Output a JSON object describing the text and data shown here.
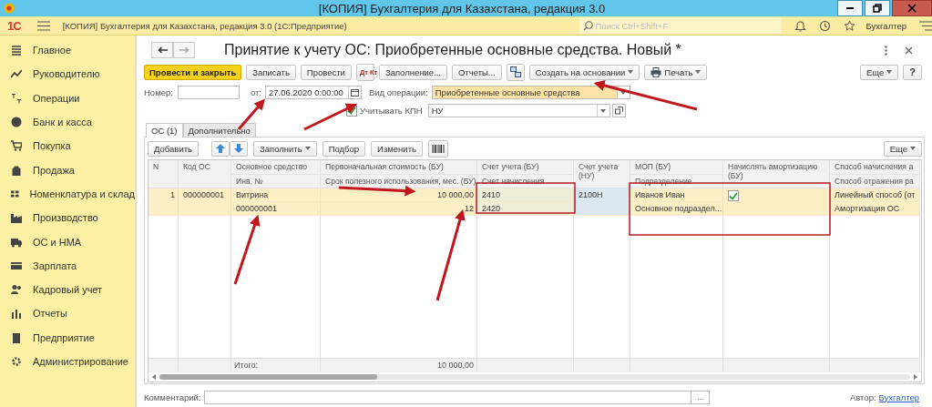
{
  "window": {
    "title": "[КОПИЯ] Бухгалтерия для Казахстана, редакция 3.0"
  },
  "app_header": {
    "logo": "1С",
    "title": "[КОПИЯ] Бухгалтерия для Казахстана, редакция 3.0  (1С:Предприятие)",
    "search": {
      "placeholder": "Поиск Ctrl+Shift+F"
    },
    "user": "Бухгалтер"
  },
  "sidebar": {
    "items": [
      {
        "label": "Главное"
      },
      {
        "label": "Руководителю"
      },
      {
        "label": "Операции"
      },
      {
        "label": "Банк и касса"
      },
      {
        "label": "Покупка"
      },
      {
        "label": "Продажа"
      },
      {
        "label": "Номенклатура и склад"
      },
      {
        "label": "Производство"
      },
      {
        "label": "ОС и НМА"
      },
      {
        "label": "Зарплата"
      },
      {
        "label": "Кадровый учет"
      },
      {
        "label": "Отчеты"
      },
      {
        "label": "Предприятие"
      },
      {
        "label": "Администрирование"
      }
    ]
  },
  "document": {
    "title": "Принятие к учету ОС: Приобретенные основные средства. Новый *",
    "toolbar": [
      {
        "kind": "primary",
        "label": "Провести и закрыть"
      },
      {
        "kind": "button",
        "label": "Записать"
      },
      {
        "kind": "button",
        "label": "Провести"
      },
      {
        "kind": "dtkt",
        "label": "Дт Кт"
      },
      {
        "kind": "button",
        "label": "Заполнение..."
      },
      {
        "kind": "button",
        "label": "Отчеты..."
      },
      {
        "kind": "structure"
      },
      {
        "kind": "menu",
        "label": "Создать на основании"
      },
      {
        "kind": "print",
        "label": "Печать"
      }
    ],
    "more_button": "Еще",
    "help_button": "?",
    "number": {
      "label": "Номер:"
    },
    "date": {
      "label": "от:",
      "value": "27.06.2020  0:00:00"
    },
    "operation": {
      "label": "Вид операции:",
      "value": "Приобретенные основные средства"
    },
    "kpn": {
      "label": "Учитывать КПН",
      "checked": true,
      "value": "НУ"
    },
    "tabs": [
      {
        "label": "ОС (1)",
        "selected": true
      },
      {
        "label": "Дополнительно",
        "selected": false
      }
    ],
    "table_toolbar": {
      "add": "Добавить",
      "fill": "Заполнить",
      "pick": "Подбор",
      "change": "Изменить",
      "more": "Еще"
    },
    "table": {
      "columns": [
        {
          "kind": "number",
          "header": "N"
        },
        {
          "kind": "text",
          "header": "Код ОС"
        },
        {
          "kind": "text",
          "header": "Основное средство",
          "subheader": "Инв. №",
          "total": "Итого:"
        },
        {
          "kind": "number",
          "header": "Первоначальная стоимость (БУ)",
          "subheader": "Срок полезного использования, мес. (БУ)",
          "total": "10 000,00"
        },
        {
          "kind": "account",
          "header": "Счет учета (БУ)",
          "subheader": "Счет начисления"
        },
        {
          "kind": "account_nu",
          "header": "Счет учета (НУ)"
        },
        {
          "kind": "text",
          "header": "МОП (БУ)",
          "subheader": "Подразделение"
        },
        {
          "kind": "check",
          "header": "Начислять амортизацию (БУ)"
        },
        {
          "kind": "text",
          "header": "Способ начисления а",
          "subheader": "Способ отражения ра"
        }
      ],
      "rows": [
        {
          "selected": true,
          "cells": [
            {
              "lines": [
                "1"
              ]
            },
            {
              "lines": [
                "000000001"
              ]
            },
            {
              "lines": [
                "Витрина",
                "000000001"
              ]
            },
            {
              "lines": [
                "10 000,00",
                "12"
              ]
            },
            {
              "lines": [
                "2410",
                "2420"
              ]
            },
            {
              "lines": [
                "2100Н"
              ]
            },
            {
              "lines": [
                "Иванов Иван",
                "Основное подраздел..."
              ]
            },
            {
              "checked": true
            },
            {
              "lines": [
                "Линейный способ (от",
                "Амортизация ОС"
              ]
            }
          ]
        }
      ]
    }
  },
  "comment": {
    "label": "Комментарий:",
    "button": "..."
  },
  "author": {
    "label": "Автор:",
    "link": "Бухгалтер"
  }
}
